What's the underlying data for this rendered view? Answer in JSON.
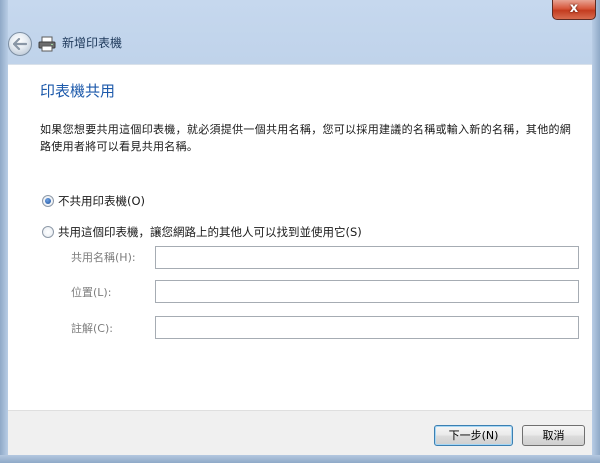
{
  "window": {
    "close_label": "x"
  },
  "header": {
    "title": "新增印表機"
  },
  "page": {
    "title": "印表機共用",
    "description": "如果您想要共用這個印表機，就必須提供一個共用名稱，您可以採用建議的名稱或輸入新的名稱，其他的網路使用者將可以看見共用名稱。"
  },
  "options": {
    "no_share": {
      "label": "不共用印表機(O)",
      "checked": true
    },
    "share": {
      "label": "共用這個印表機，讓您網路上的其他人可以找到並使用它(S)",
      "checked": false
    }
  },
  "fields": {
    "share_name": {
      "label": "共用名稱(H):",
      "value": ""
    },
    "location": {
      "label": "位置(L):",
      "value": ""
    },
    "comment": {
      "label": "註解(C):",
      "value": ""
    }
  },
  "footer": {
    "next_label": "下一步(N)",
    "cancel_label": "取消"
  },
  "colors": {
    "title": "#1d5aab",
    "disabled_label": "#7d7d7d"
  },
  "icons": {
    "back": "back-arrow-icon",
    "printer": "printer-icon",
    "close": "close-icon"
  }
}
